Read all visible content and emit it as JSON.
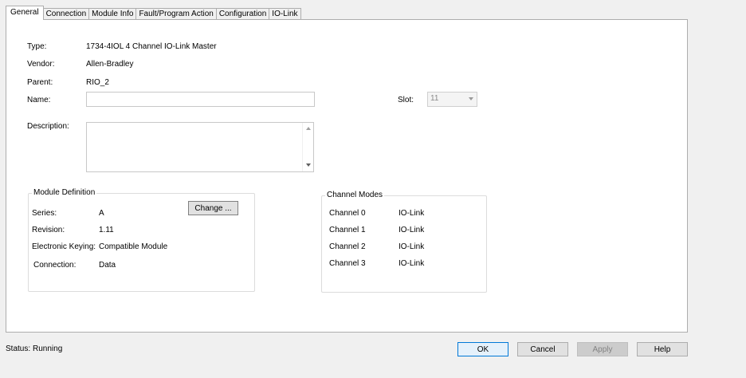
{
  "tabs": [
    "General",
    "Connection",
    "Module Info",
    "Fault/Program Action",
    "Configuration",
    "IO-Link"
  ],
  "active_tab": "General",
  "general": {
    "type_label": "Type:",
    "type_value": "1734-4IOL 4 Channel IO-Link Master",
    "vendor_label": "Vendor:",
    "vendor_value": "Allen-Bradley",
    "parent_label": "Parent:",
    "parent_value": "RIO_2",
    "name_label": "Name:",
    "name_value": "",
    "slot_label": "Slot:",
    "slot_value": "11",
    "description_label": "Description:",
    "description_value": ""
  },
  "module_definition": {
    "title": "Module Definition",
    "change_button": "Change ...",
    "rows": [
      {
        "label": "Series:",
        "value": "A"
      },
      {
        "label": "Revision:",
        "value": "1.11"
      },
      {
        "label": "Electronic Keying:",
        "value": "Compatible Module"
      },
      {
        "label": "Connection:",
        "value": "Data"
      }
    ]
  },
  "channel_modes": {
    "title": "Channel Modes",
    "rows": [
      {
        "label": "Channel 0",
        "value": "IO-Link"
      },
      {
        "label": "Channel 1",
        "value": "IO-Link"
      },
      {
        "label": "Channel 2",
        "value": "IO-Link"
      },
      {
        "label": "Channel 3",
        "value": "IO-Link"
      }
    ]
  },
  "footer": {
    "status_label": "Status:",
    "status_value": "Running",
    "ok": "OK",
    "cancel": "Cancel",
    "apply": "Apply",
    "help": "Help"
  },
  "colors": {
    "default_button_border": "#0078d7",
    "panel_background": "#ffffff",
    "window_background": "#f0f0f0"
  }
}
